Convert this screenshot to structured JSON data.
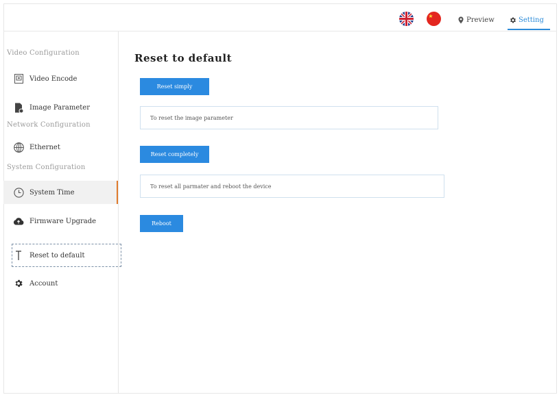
{
  "header": {
    "flags": [
      {
        "name": "english-flag",
        "lang": "English"
      },
      {
        "name": "chinese-flag",
        "lang": "Chinese"
      }
    ],
    "nav": {
      "preview_label": "Preview",
      "setting_label": "Setting"
    },
    "accent_color": "#2b8ad8"
  },
  "sidebar": {
    "sections": {
      "video": "Video Configuration",
      "network": "Network Configuration",
      "system": "System Configuration"
    },
    "items": [
      {
        "label": "Video Encode",
        "icon": "video-encode-icon"
      },
      {
        "label": "Image Parameter",
        "icon": "image-file-icon"
      },
      {
        "label": "Ethernet",
        "icon": "globe-icon"
      },
      {
        "label": "System Time",
        "icon": "clock-icon"
      },
      {
        "label": "Firmware Upgrade",
        "icon": "cloud-upload-icon"
      },
      {
        "label": "Reset to default",
        "icon": "text-cursor-icon"
      },
      {
        "label": "Account",
        "icon": "gear-icon"
      }
    ],
    "active_item": "System Time",
    "active_indicator_color": "#e07a2c"
  },
  "main": {
    "title": "Reset to default",
    "reset_simply_label": "Reset simply",
    "reset_simply_desc": "To reset the image parameter",
    "reset_completely_label": "Reset completely",
    "reset_completely_desc": "To reset all parmater and reboot the device",
    "reboot_label": "Reboot",
    "button_color": "#2b8ae0"
  }
}
